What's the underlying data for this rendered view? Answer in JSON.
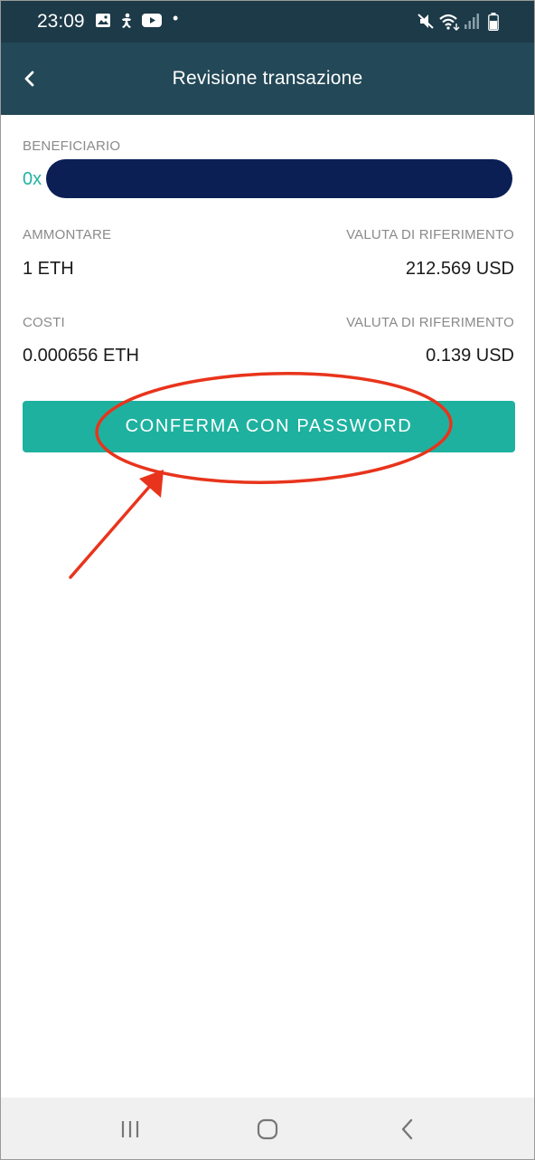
{
  "status_bar": {
    "time": "23:09",
    "left_icons": [
      "image-icon",
      "accessibility-icon",
      "youtube-icon"
    ],
    "right_icons": [
      "mute-icon",
      "wifi-icon",
      "signal-icon",
      "battery-icon"
    ]
  },
  "header": {
    "title": "Revisione transazione",
    "back_icon": "chevron-left-icon"
  },
  "recipient": {
    "label": "BENEFICIARIO",
    "address_visible_prefix": "0x"
  },
  "amount": {
    "label": "AMMONTARE",
    "value": "1 ETH",
    "reference_label": "VALUTA DI RIFERIMENTO",
    "reference_value": "212.569 USD"
  },
  "fees": {
    "label": "COSTI",
    "value": "0.000656 ETH",
    "reference_label": "VALUTA DI RIFERIMENTO",
    "reference_value": "0.139 USD"
  },
  "actions": {
    "confirm_label": "CONFERMA CON PASSWORD"
  },
  "colors": {
    "status_bar": "#1c3a48",
    "app_bar": "#234857",
    "accent": "#1eb19f",
    "address_text": "#20b2a5",
    "redaction": "#0b1f55",
    "annotation": "#e8341c",
    "nav_bar": "#f0f0f0"
  },
  "navigation_bar": {
    "icons": [
      "recent-apps-icon",
      "home-icon",
      "back-icon"
    ]
  }
}
